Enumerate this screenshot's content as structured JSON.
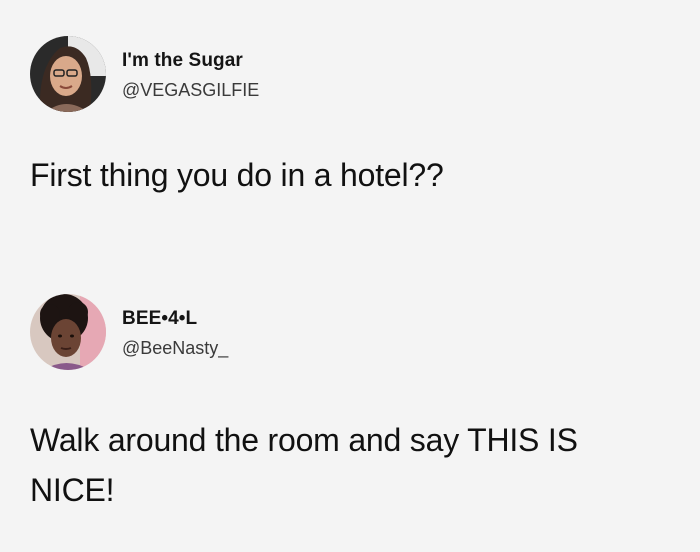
{
  "tweets": [
    {
      "display_name": "I'm the Sugar",
      "handle": "@VEGASGILFIE",
      "text": "First thing you do in a hotel??"
    },
    {
      "display_name": "BEE•4•L",
      "handle": "@BeeNasty_",
      "text": "Walk around the room and say THIS IS NICE!"
    }
  ],
  "colors": {
    "background": "#f4f4f4",
    "text": "#111111",
    "handle": "#3a3a3a"
  }
}
